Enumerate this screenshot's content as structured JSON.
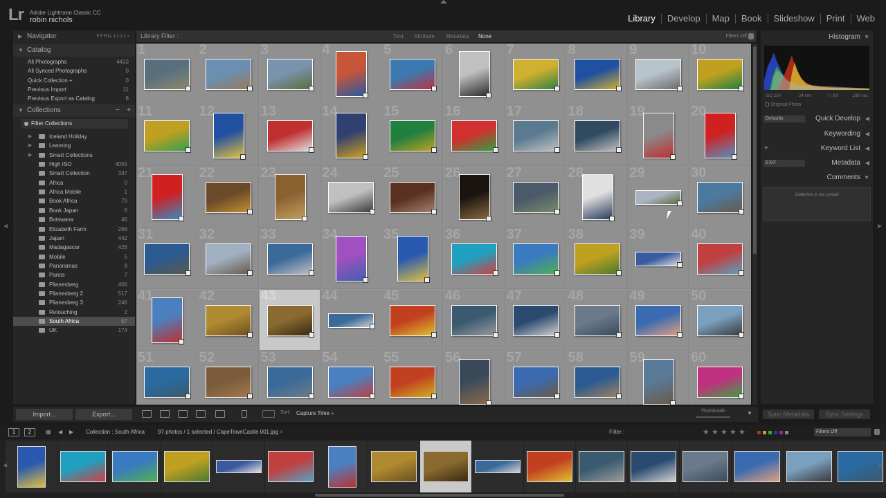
{
  "identity": {
    "logo": "Lr",
    "app": "Adobe Lightroom Classic CC",
    "user": "robin nichols"
  },
  "modules": [
    "Library",
    "Develop",
    "Map",
    "Book",
    "Slideshow",
    "Print",
    "Web"
  ],
  "left_panel": {
    "navigator": {
      "title": "Navigator",
      "zoom_options": "FIT  FILL  1:1  2:1 ÷"
    },
    "catalog": {
      "title": "Catalog",
      "items": [
        {
          "label": "All Photographs",
          "count": "4433"
        },
        {
          "label": "All Synced Photographs",
          "count": "0"
        },
        {
          "label": "Quick Collection +",
          "count": "0"
        },
        {
          "label": "Previous Import",
          "count": "11"
        },
        {
          "label": "Previous Export as Catalog",
          "count": "8"
        }
      ]
    },
    "collections": {
      "title": "Collections",
      "filter_label": "Filter Collections",
      "items": [
        {
          "label": "Iceland Holiday",
          "count": ""
        },
        {
          "label": "Learning",
          "count": ""
        },
        {
          "label": "Smart Collections",
          "count": ""
        },
        {
          "label": "High ISO",
          "count": "4055"
        },
        {
          "label": "Smart Collection",
          "count": "337"
        },
        {
          "label": "Africa",
          "count": "0"
        },
        {
          "label": "Africa Mobile",
          "count": "1"
        },
        {
          "label": "Book Africa",
          "count": "70"
        },
        {
          "label": "Book Japan",
          "count": "6"
        },
        {
          "label": "Botswana",
          "count": "46"
        },
        {
          "label": "Elizabeth Farm",
          "count": "266"
        },
        {
          "label": "Japan",
          "count": "442"
        },
        {
          "label": "Madagascar",
          "count": "428"
        },
        {
          "label": "Mobile",
          "count": "5"
        },
        {
          "label": "Panoramas",
          "count": "8"
        },
        {
          "label": "Panos",
          "count": "7"
        },
        {
          "label": "Pilanesberg",
          "count": "406"
        },
        {
          "label": "Pilanesberg 2",
          "count": "517"
        },
        {
          "label": "Pilanesberg 3",
          "count": "246"
        },
        {
          "label": "Retouching",
          "count": "2"
        },
        {
          "label": "South Africa",
          "count": "97"
        },
        {
          "label": "UK",
          "count": "174"
        }
      ]
    },
    "import_button": "Import...",
    "export_button": "Export..."
  },
  "right_panel": {
    "histogram_title": "Histogram",
    "exif": {
      "iso": "ISO 250",
      "focal": "24 mm",
      "aperture": "f / 9.0",
      "shutter": "1/80 sec"
    },
    "original_photo": "Original Photo",
    "quick_develop": "Quick Develop",
    "quick_develop_preset": "Defaults",
    "keywording": "Keywording",
    "keyword_list": "Keyword List",
    "metadata": "Metadata",
    "metadata_preset": "EXIF",
    "comments": "Comments",
    "comments_note": "Collection is not synced",
    "sync_metadata": "Sync Metadata",
    "sync_settings": "Sync Settings"
  },
  "filter_bar": {
    "label": "Library Filter :",
    "options": [
      "Text",
      "Attribute",
      "Metadata",
      "None"
    ],
    "filters_off": "Filters Off"
  },
  "grid": {
    "selected_index": 43,
    "cells": [
      {
        "n": "1",
        "c": "#5a6f7e",
        "c2": "#8b8a6a",
        "o": "h"
      },
      {
        "n": "2",
        "c": "#6a8fb3",
        "c2": "#9a7a5a",
        "o": "h"
      },
      {
        "n": "3",
        "c": "#7a93ad",
        "c2": "#5a6a3a",
        "o": "h"
      },
      {
        "n": "4",
        "c": "#c8553a",
        "c2": "#2a5aa0",
        "o": "v"
      },
      {
        "n": "5",
        "c": "#3a7ab0",
        "c2": "#c03040",
        "o": "h"
      },
      {
        "n": "6",
        "c": "#c0c0c0",
        "c2": "#2a2a2a",
        "o": "v"
      },
      {
        "n": "7",
        "c": "#d0b030",
        "c2": "#308040",
        "o": "h"
      },
      {
        "n": "8",
        "c": "#2050a0",
        "c2": "#d0b030",
        "o": "h"
      },
      {
        "n": "9",
        "c": "#b8c4cc",
        "c2": "#6a6a6a",
        "o": "h"
      },
      {
        "n": "10",
        "c": "#c0a020",
        "c2": "#208040",
        "o": "h"
      },
      {
        "n": "11",
        "c": "#c0a020",
        "c2": "#30a050",
        "o": "h"
      },
      {
        "n": "12",
        "c": "#2050a0",
        "c2": "#e0c040",
        "o": "v"
      },
      {
        "n": "13",
        "c": "#c03030",
        "c2": "#e0e0e0",
        "o": "h"
      },
      {
        "n": "14",
        "c": "#304070",
        "c2": "#d0a020",
        "o": "v"
      },
      {
        "n": "15",
        "c": "#208040",
        "c2": "#c0a020",
        "o": "h"
      },
      {
        "n": "16",
        "c": "#d03030",
        "c2": "#30a040",
        "o": "h"
      },
      {
        "n": "17",
        "c": "#5a7a90",
        "c2": "#c0c0c0",
        "o": "h"
      },
      {
        "n": "18",
        "c": "#304a60",
        "c2": "#c0c0c0",
        "o": "h"
      },
      {
        "n": "19",
        "c": "#8a8a8a",
        "c2": "#c03030",
        "o": "v"
      },
      {
        "n": "20",
        "c": "#d02020",
        "c2": "#5a90c0",
        "o": "v"
      },
      {
        "n": "21",
        "c": "#d02020",
        "c2": "#3a8ac0",
        "o": "v"
      },
      {
        "n": "22",
        "c": "#6a4a2a",
        "c2": "#c09030",
        "o": "h"
      },
      {
        "n": "23",
        "c": "#8a6030",
        "c2": "#c0a060",
        "o": "v"
      },
      {
        "n": "24",
        "c": "#c0c0c0",
        "c2": "#3a3a3a",
        "o": "h"
      },
      {
        "n": "25",
        "c": "#5a3020",
        "c2": "#a08070",
        "o": "h"
      },
      {
        "n": "26",
        "c": "#1a1410",
        "c2": "#8a6a40",
        "o": "v"
      },
      {
        "n": "27",
        "c": "#4a5a6a",
        "c2": "#7a8a6a",
        "o": "h"
      },
      {
        "n": "28",
        "c": "#e0e0e0",
        "c2": "#2a3a5a",
        "o": "v"
      },
      {
        "n": "29",
        "c": "#aab4c0",
        "c2": "#5a6a3a",
        "o": "p"
      },
      {
        "n": "30",
        "c": "#4a7aa0",
        "c2": "#6a5a4a",
        "o": "h"
      },
      {
        "n": "31",
        "c": "#2a5a90",
        "c2": "#5a5a4a",
        "o": "h"
      },
      {
        "n": "32",
        "c": "#a0b0c0",
        "c2": "#6a5a4a",
        "o": "h"
      },
      {
        "n": "33",
        "c": "#3a6a9a",
        "c2": "#c0c0c0",
        "o": "h"
      },
      {
        "n": "34",
        "c": "#a050c0",
        "c2": "#4060b0",
        "o": "v"
      },
      {
        "n": "35",
        "c": "#2a5ab0",
        "c2": "#e0c040",
        "o": "v"
      },
      {
        "n": "36",
        "c": "#20a0c0",
        "c2": "#d04040",
        "o": "h"
      },
      {
        "n": "37",
        "c": "#3a7ac0",
        "c2": "#50b050",
        "o": "h"
      },
      {
        "n": "38",
        "c": "#c0a020",
        "c2": "#4a7a30",
        "o": "h"
      },
      {
        "n": "39",
        "c": "#3a5aa0",
        "c2": "#e0e0e0",
        "o": "p"
      },
      {
        "n": "40",
        "c": "#c04040",
        "c2": "#5aa0c0",
        "o": "h"
      },
      {
        "n": "41",
        "c": "#4a80c0",
        "c2": "#c03030",
        "o": "v"
      },
      {
        "n": "42",
        "c": "#b08a30",
        "c2": "#6a5020",
        "o": "h"
      },
      {
        "n": "43",
        "c": "#8a6a30",
        "c2": "#3a2a10",
        "o": "h"
      },
      {
        "n": "44",
        "c": "#3a6a9a",
        "c2": "#d0d0d0",
        "o": "p"
      },
      {
        "n": "45",
        "c": "#c04020",
        "c2": "#e0c030",
        "o": "h"
      },
      {
        "n": "46",
        "c": "#3a5a70",
        "c2": "#9a9a9a",
        "o": "h"
      },
      {
        "n": "47",
        "c": "#2a4a70",
        "c2": "#d0d0d0",
        "o": "h"
      },
      {
        "n": "48",
        "c": "#6a7a8a",
        "c2": "#3a4a5a",
        "o": "h"
      },
      {
        "n": "49",
        "c": "#3a6ab0",
        "c2": "#e0a080",
        "o": "h"
      },
      {
        "n": "50",
        "c": "#7aa0c0",
        "c2": "#3a3a3a",
        "o": "h"
      },
      {
        "n": "51",
        "c": "#2a6aa0",
        "c2": "#3a5a6a",
        "o": "h"
      },
      {
        "n": "52",
        "c": "#7a5a3a",
        "c2": "#a07a50",
        "o": "h"
      },
      {
        "n": "53",
        "c": "#3a6a9a",
        "c2": "#6a7a8a",
        "o": "h"
      },
      {
        "n": "54",
        "c": "#4a80c0",
        "c2": "#c04040",
        "o": "h"
      },
      {
        "n": "55",
        "c": "#c04020",
        "c2": "#d0b020",
        "o": "h"
      },
      {
        "n": "56",
        "c": "#3a4a5a",
        "c2": "#8a6a4a",
        "o": "v"
      },
      {
        "n": "57",
        "c": "#3a6ab0",
        "c2": "#6a5a4a",
        "o": "h"
      },
      {
        "n": "58",
        "c": "#2a5a90",
        "c2": "#a08060",
        "o": "h"
      },
      {
        "n": "59",
        "c": "#5a7a9a",
        "c2": "#6a5a4a",
        "o": "v"
      },
      {
        "n": "60",
        "c": "#c03080",
        "c2": "#40a040",
        "o": "h"
      }
    ]
  },
  "toolbar": {
    "sort_label": "Sort:",
    "sort_value": "Capture Time ÷",
    "thumbnails_label": "Thumbnails"
  },
  "filmstrip_header": {
    "pages": [
      "1",
      "2"
    ],
    "crumb": "Collection : South Africa",
    "selection": "97 photos / 1 selected / CapeTownCastle 001.jpg ÷",
    "filter_label": "Filter :",
    "filter_value": "Filters Off"
  },
  "filmstrip": [
    {
      "c": "#2a5ab0",
      "c2": "#e0c040",
      "o": "v"
    },
    {
      "c": "#20a0c0",
      "c2": "#d04040",
      "o": "h"
    },
    {
      "c": "#3a7ac0",
      "c2": "#50b050",
      "o": "h"
    },
    {
      "c": "#c0a020",
      "c2": "#4a7a30",
      "o": "h"
    },
    {
      "c": "#3a5aa0",
      "c2": "#e0e0e0",
      "o": "p"
    },
    {
      "c": "#c04040",
      "c2": "#5aa0c0",
      "o": "h"
    },
    {
      "c": "#4a80c0",
      "c2": "#c03030",
      "o": "v"
    },
    {
      "c": "#b08a30",
      "c2": "#6a5020",
      "o": "h"
    },
    {
      "c": "#8a6a30",
      "c2": "#3a2a10",
      "o": "h"
    },
    {
      "c": "#3a6a9a",
      "c2": "#d0d0d0",
      "o": "p"
    },
    {
      "c": "#c04020",
      "c2": "#e0c030",
      "o": "h"
    },
    {
      "c": "#3a5a70",
      "c2": "#9a9a9a",
      "o": "h"
    },
    {
      "c": "#2a4a70",
      "c2": "#d0d0d0",
      "o": "h"
    },
    {
      "c": "#6a7a8a",
      "c2": "#3a4a5a",
      "o": "h"
    },
    {
      "c": "#3a6ab0",
      "c2": "#e0a080",
      "o": "h"
    },
    {
      "c": "#7aa0c0",
      "c2": "#3a3a3a",
      "o": "h"
    },
    {
      "c": "#2a6aa0",
      "c2": "#3a5a6a",
      "o": "h"
    }
  ],
  "filmstrip_selected": 8
}
